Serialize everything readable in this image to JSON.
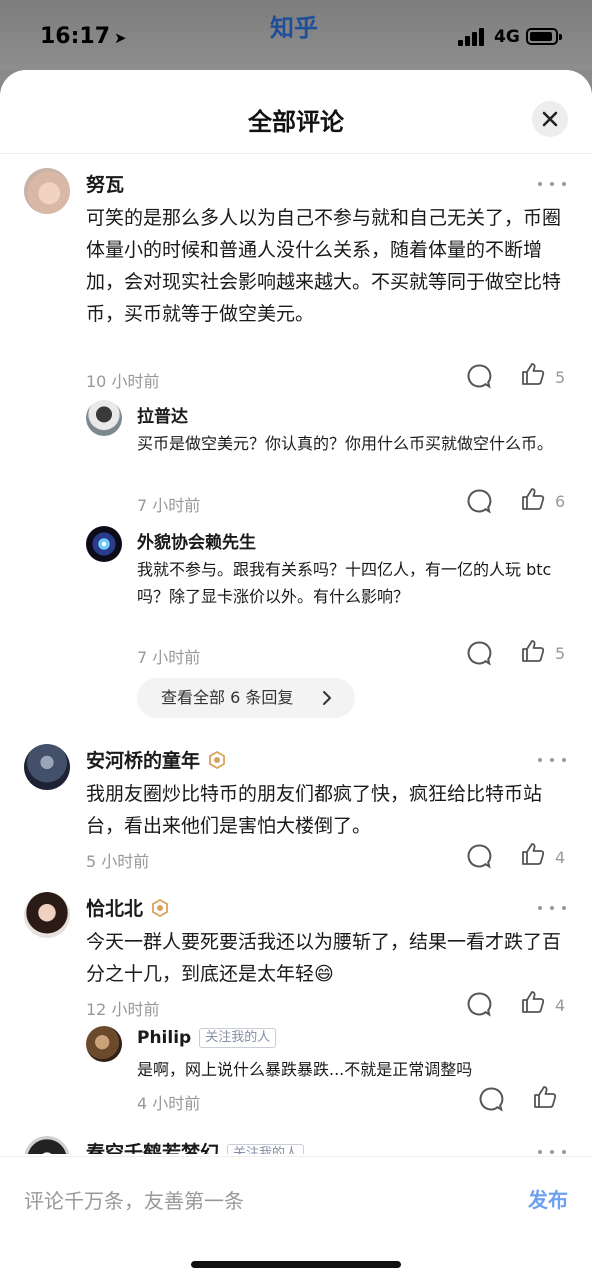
{
  "status_bar": {
    "time": "16:17",
    "app_logo": "知乎",
    "network": "4G"
  },
  "sheet": {
    "title": "全部评论"
  },
  "comments": [
    {
      "name": "努瓦",
      "text": "可笑的是那么多人以为自己不参与就和自己无关了，币圈体量小的时候和普通人没什么关系，随着体量的不断增加，会对现实社会影响越来越大。不买就等同于做空比特币，买币就等于做空美元。",
      "time": "10 小时前",
      "likes": "5",
      "replies": [
        {
          "name": "拉普达",
          "text": "买币是做空美元？你认真的？你用什么币买就做空什么币。",
          "time": "7 小时前",
          "likes": "6"
        },
        {
          "name": "外貌协会赖先生",
          "text": "我就不参与。跟我有关系吗？十四亿人，有一亿的人玩 btc 吗？除了显卡涨价以外。有什么影响？",
          "time": "7 小时前",
          "likes": "5"
        }
      ],
      "see_all": "查看全部 6 条回复"
    },
    {
      "name": "安河桥的童年",
      "text": "我朋友圈炒比特币的朋友们都疯了快，疯狂给比特币站台，看出来他们是害怕大楼倒了。",
      "time": "5 小时前",
      "likes": "4"
    },
    {
      "name": "恰北北",
      "text": "今天一群人要死要活我还以为腰斩了，结果一看才跌了百分之十几，到底还是太年轻",
      "emoji": "😄",
      "time": "12 小时前",
      "likes": "4",
      "replies": [
        {
          "name": "Philip",
          "tag": "关注我的人",
          "text": "是啊，网上说什么暴跌暴跌...不就是正常调整吗",
          "time": "4 小时前"
        }
      ]
    },
    {
      "name": "春空千鹤若梦幻",
      "tag": "关注我的人"
    }
  ],
  "input_bar": {
    "placeholder": "评论千万条，友善第一条",
    "publish": "发布"
  },
  "colors": {
    "accent": "#6ea0f0",
    "muted": "#999999",
    "badge": "#d6a25a"
  }
}
